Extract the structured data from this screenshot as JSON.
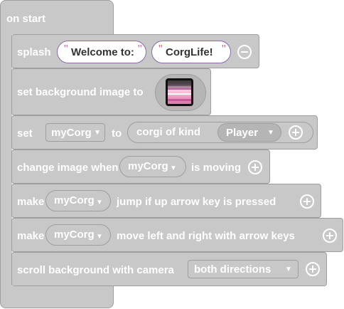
{
  "hat": {
    "label": "on start"
  },
  "splash": {
    "label": "splash",
    "arg1": "Welcome to:",
    "arg2": "CorgLife!",
    "quote_open": "\"",
    "quote_close": "\""
  },
  "set_background": {
    "label": "set background image to"
  },
  "set_var": {
    "label": "set",
    "variable": "myCorg",
    "to_label": "to",
    "inner_label": "corgi of kind",
    "kind": "Player"
  },
  "change_image": {
    "label": "change image when",
    "variable": "myCorg",
    "suffix": "is moving"
  },
  "jump": {
    "prefix": "make",
    "variable": "myCorg",
    "suffix": "jump if up arrow key is pressed"
  },
  "move": {
    "prefix": "make",
    "variable": "myCorg",
    "suffix": "move left and right with arrow keys"
  },
  "scroll": {
    "label": "scroll background with camera",
    "option": "both directions"
  },
  "colors": {
    "block": "#c8c8c8",
    "border": "#9e9e9e",
    "text": "#ffffff",
    "string_border": "#8a6aa8",
    "quote": "#e0669a"
  },
  "icons": {
    "caret": "caret-down-icon",
    "add": "plus-circle-icon",
    "remove": "minus-circle-icon"
  }
}
